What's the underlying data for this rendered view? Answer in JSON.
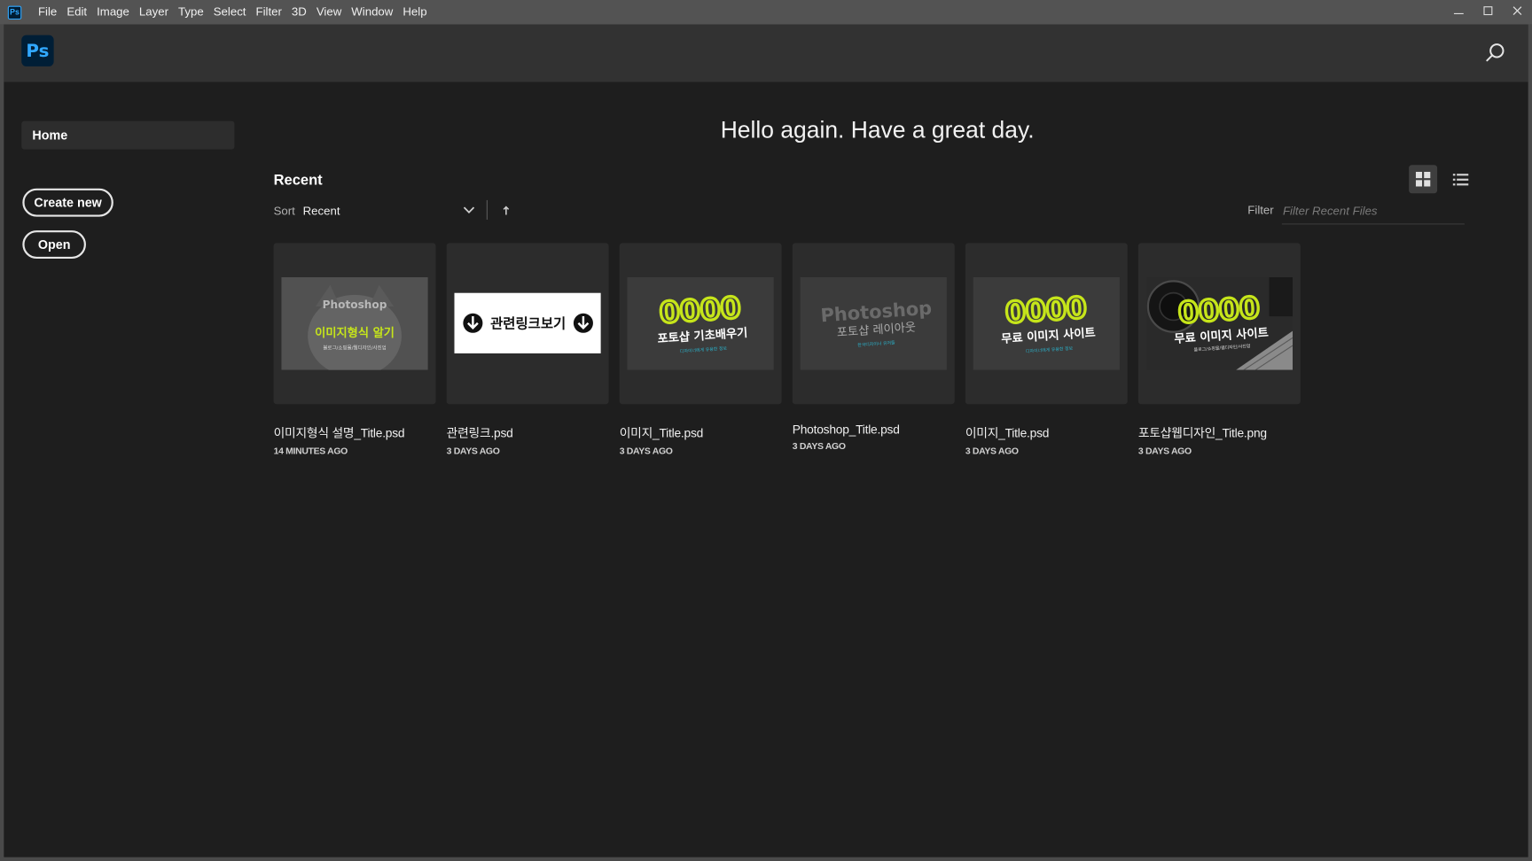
{
  "menubar": {
    "app_icon": "Ps",
    "items": [
      "File",
      "Edit",
      "Image",
      "Layer",
      "Type",
      "Select",
      "Filter",
      "3D",
      "View",
      "Window",
      "Help"
    ],
    "controls": {
      "minimize": "—",
      "maximize": "☐",
      "close": "✕"
    }
  },
  "header": {
    "logo": "Ps",
    "search_icon": "search-icon"
  },
  "sidebar": {
    "home_label": "Home",
    "create_new_label": "Create new",
    "open_label": "Open"
  },
  "main": {
    "greeting": "Hello again. Have a great day.",
    "recent_title": "Recent",
    "sort_label": "Sort",
    "sort_value": "Recent",
    "filter_label": "Filter",
    "filter_placeholder": "Filter Recent Files"
  },
  "colors": {
    "accent": "#31a8ff",
    "background": "#1e1e1e",
    "header": "#323232",
    "lime": "#c6e51a"
  },
  "files": [
    {
      "name": "이미지형식 설명_Title.psd",
      "time": "14 MINUTES AGO",
      "thumb_line1": "Photoshop",
      "thumb_line2": "이미지형식 알기",
      "thumb_line3": "블로그/쇼핑몰/웹디자인/사진업"
    },
    {
      "name": "관련링크.psd",
      "time": "3 DAYS AGO",
      "thumb_line1": "관련링크보기"
    },
    {
      "name": "이미지_Title.psd",
      "time": "3 DAYS AGO",
      "thumb_line1": "0000",
      "thumb_line2": "포토샵 기초배우기",
      "thumb_line3": "디자이너에게 유용한 정보"
    },
    {
      "name": "Photoshop_Title.psd",
      "time": "3 DAYS AGO",
      "thumb_line1": "Photoshop",
      "thumb_line2": "포토샵 레이아웃",
      "thumb_line3": "한국디자이너 유저들"
    },
    {
      "name": "이미지_Title.psd",
      "time": "3 DAYS AGO",
      "thumb_line1": "0000",
      "thumb_line2": "무료 이미지 사이트",
      "thumb_line3": "디자이너에게 유용한 정보"
    },
    {
      "name": "포토샵웹디자인_Title.png",
      "time": "3 DAYS AGO",
      "thumb_line1": "0000",
      "thumb_line2": "무료 이미지 사이트",
      "thumb_line3": "블로그/쇼핑몰/웹디자인/사진업"
    }
  ]
}
